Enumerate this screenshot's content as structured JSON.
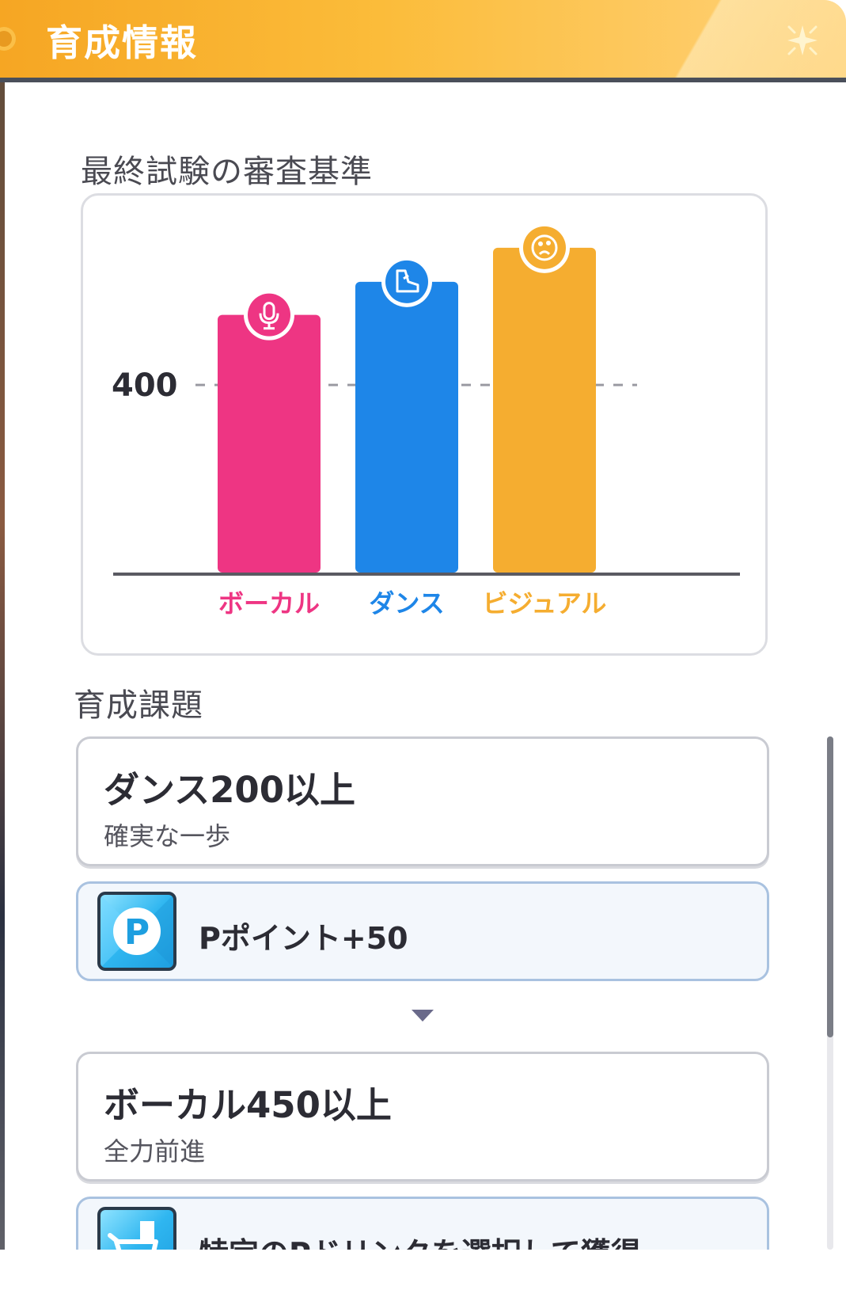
{
  "header": {
    "title": "育成情報"
  },
  "criteria": {
    "heading": "最終試験の審査基準"
  },
  "chart_data": {
    "type": "bar",
    "categories": [
      "ボーカル",
      "ダンス",
      "ビジュアル"
    ],
    "values": [
      548,
      618,
      690
    ],
    "colors": [
      "#ee3583",
      "#1e86e8",
      "#f5ad30"
    ],
    "icons": [
      "microphone-icon",
      "dance-shoe-icon",
      "visual-palette-icon"
    ],
    "reference_line": {
      "value": 400,
      "label": "400"
    },
    "ylim": [
      0,
      750
    ],
    "grid": false
  },
  "tasks": {
    "heading": "育成課題",
    "items": [
      {
        "title": "ダンス200以上",
        "subtitle": "確実な一歩",
        "reward": {
          "icon": "p-point-icon",
          "text": "Pポイント+50"
        }
      },
      {
        "title": "ボーカル450以上",
        "subtitle": "全力前進",
        "reward": {
          "icon": "p-drink-cart-icon",
          "text": "特定のPドリンクを選択して獲得"
        }
      }
    ]
  }
}
